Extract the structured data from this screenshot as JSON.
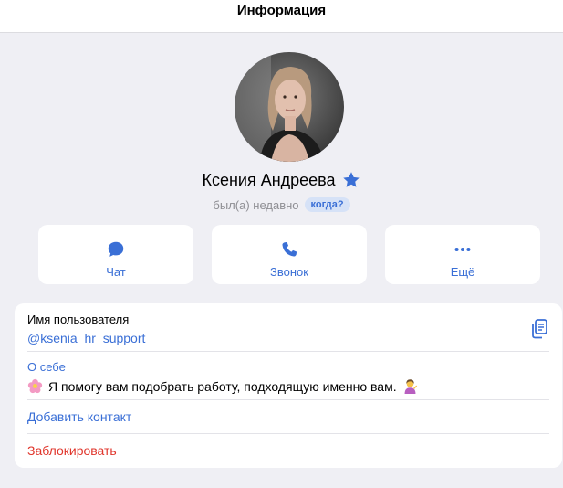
{
  "header": {
    "title": "Информация"
  },
  "profile": {
    "name": "Ксения Андреева",
    "status": "был(а) недавно",
    "when_badge": "когда?",
    "avatar_icon": "profile-photo",
    "verified_icon": "star-icon"
  },
  "actions": [
    {
      "label": "Чат",
      "icon": "chat-bubble-icon"
    },
    {
      "label": "Звонок",
      "icon": "phone-icon"
    },
    {
      "label": "Ещё",
      "icon": "more-dots-icon"
    }
  ],
  "info": {
    "username_label": "Имя пользователя",
    "username": "@ksenia_hr_support",
    "about_label": "О себе",
    "about_text": "Я помогу вам подобрать работу, подходящую именно вам.",
    "add_contact": "Добавить контакт",
    "block": "Заблокировать"
  },
  "colors": {
    "accent": "#3a6fd6",
    "danger": "#e0352b",
    "background": "#efeff4",
    "card": "#ffffff"
  }
}
